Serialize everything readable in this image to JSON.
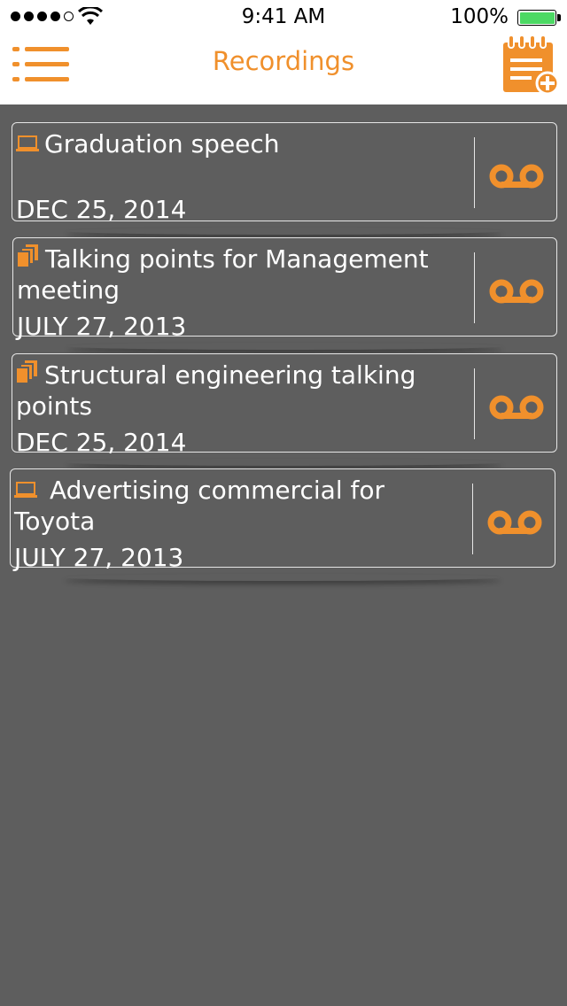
{
  "status_bar": {
    "time": "9:41 AM",
    "battery_percent": "100%",
    "signal_bars_filled": 4,
    "signal_bars_total": 5,
    "battery_level": 1.0,
    "battery_color": "#4cd964"
  },
  "header": {
    "title": "Recordings",
    "menu_icon": "list-menu-icon",
    "add_icon": "notepad-add-icon"
  },
  "accent_color": "#f0902c",
  "recordings": [
    {
      "name": "Graduation speech",
      "date": "DEC 25, 2014",
      "type_icon": "laptop-icon"
    },
    {
      "name": "Talking points for Management meeting",
      "date": "JULY 27, 2013",
      "type_icon": "documents-icon"
    },
    {
      "name": "Structural engineering talking points",
      "date": "DEC 25, 2014",
      "type_icon": "documents-icon"
    },
    {
      "name": "Advertising commercial for Toyota",
      "date": "JULY 27, 2013",
      "type_icon": "laptop-icon"
    }
  ]
}
